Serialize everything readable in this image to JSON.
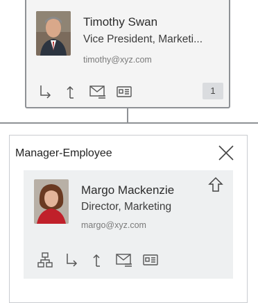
{
  "manager": {
    "name": "Timothy Swan",
    "title": "Vice President, Marketi...",
    "email": "timothy@xyz.com",
    "badge": "1",
    "actions": [
      "reports-to-icon",
      "go-up-icon",
      "email-icon",
      "contact-card-icon"
    ]
  },
  "panel": {
    "title": "Manager-Employee",
    "close_icon": "close-icon"
  },
  "employee": {
    "name": "Margo Mackenzie",
    "title": "Director, Marketing",
    "email": "margo@xyz.com",
    "up_icon": "arrow-up-icon",
    "actions": [
      "org-chart-icon",
      "reports-to-icon",
      "go-up-icon",
      "email-icon",
      "contact-card-icon"
    ]
  },
  "colors": {
    "card_bg": "#f4f4f4",
    "card_border": "#8e9195",
    "inner_bg": "#eef0f1",
    "icon": "#555555"
  }
}
